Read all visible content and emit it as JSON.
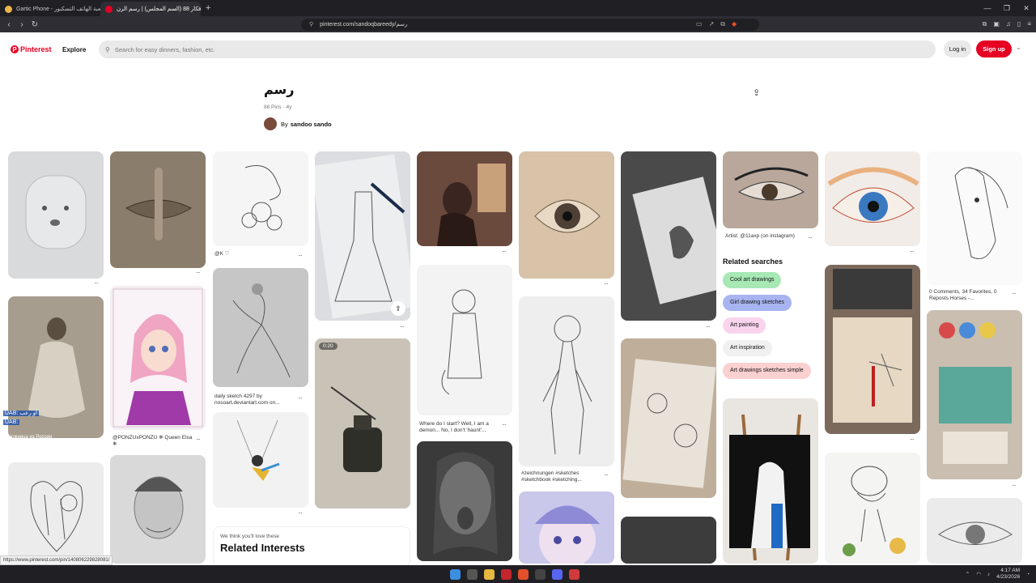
{
  "browser": {
    "tabs": [
      {
        "label": "Gartic Phone - لعبة الهاتف التسكبور"
      },
      {
        "label": "أفكار 88 (السم المجلس) | رسم الرن..."
      }
    ],
    "url": "pinterest.com/sandoqbareedy/رسم"
  },
  "header": {
    "logo": "Pinterest",
    "explore": "Explore",
    "search_placeholder": "Search for easy dinners, fashion, etc.",
    "login": "Log in",
    "signup": "Sign up"
  },
  "board": {
    "title": "رسم",
    "meta": "88 Pins · 4y",
    "by": "By",
    "author": "sandoo sando"
  },
  "pins": {
    "c3_1": "@K ♡",
    "c3_2": "daily sketch 4297 by nosoart.deviantart.com on...",
    "c2_2": "@PONZUxPONZU ❄ Queen Elsa ❄",
    "c5_2": "Where do I start? Well, I am a demon... No, I don't 'haunt'...",
    "c6_2": "#zeichnungen #sketches #sketchbook #sketching...",
    "c8_1": "Artist: @11axp (on instagram)",
    "c10_1": "0 Comments, 34 Favorites, 0 Reposts Horses -...",
    "video_time": "0:20"
  },
  "related": {
    "heading": "Related searches",
    "chips": [
      {
        "label": "Cool art drawings",
        "color": "#a7e8b5"
      },
      {
        "label": "Girl drawing sketches",
        "color": "#a8b4f0"
      },
      {
        "label": "Art painting",
        "color": "#f9d4ec"
      },
      {
        "label": "Art inspiration",
        "color": "#f0f0f0"
      },
      {
        "label": "Art drawings sketches simple",
        "color": "#fbd0d0"
      }
    ]
  },
  "interests": {
    "small": "We think you'll love these",
    "big": "Related Interests"
  },
  "status_url": "https://www.pinterest.com/pin/140806229828081/",
  "overlay": {
    "l1": "UAB: او رعب",
    "l2": "UAB:",
    "l3": "Художница из России",
    "l4": "ЧИГ: и именем..."
  },
  "taskbar": {
    "time": "4:17 AM",
    "date": "4/23/2026"
  }
}
